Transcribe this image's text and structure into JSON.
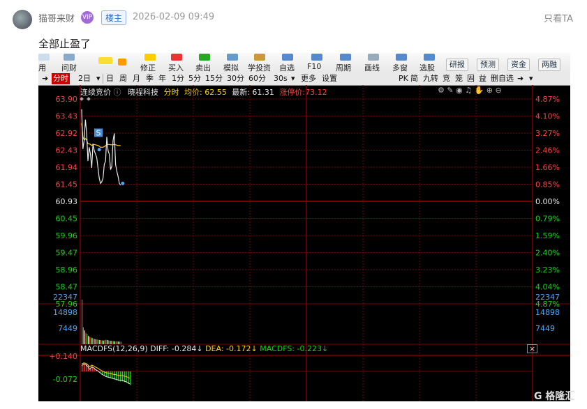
{
  "post": {
    "username": "猫哥来财",
    "vip_badge": "VIP",
    "owner_tag": "楼主",
    "timestamp": "2026-02-09 09:49",
    "only_ta": "只看TA",
    "content": "全部止盈了"
  },
  "toolbar": {
    "items": [
      "用",
      "问财",
      "修正",
      "买入",
      "卖出",
      "模拟",
      "学投资",
      "自选",
      "F10",
      "周期",
      "画线",
      "多窗",
      "选股"
    ],
    "buttons": [
      "研报",
      "预测",
      "资金",
      "两融"
    ]
  },
  "tabs": {
    "left": [
      "分时",
      "2日",
      "日",
      "周",
      "月",
      "季",
      "年",
      "1分",
      "5分",
      "15分",
      "30分",
      "60分",
      "30s",
      "更多",
      "设置"
    ],
    "right": [
      "PK",
      "简",
      "九转",
      "竞",
      "笼",
      "固",
      "益",
      "删自选"
    ]
  },
  "info": {
    "auction": "连续竞价",
    "stock": "晓程科技",
    "mode": "分时",
    "avg_label": "均价: 62.55",
    "latest_label": "最新: 61.31",
    "limit_label": "涨停价:73.12"
  },
  "macd": {
    "title": "MACDFS(12,26,9)",
    "diff": "DIFF: -0.284↓",
    "dea": "DEA: -0.172↓",
    "macdfs": "MACDFS: -0.223↓",
    "close": "×"
  },
  "axes": {
    "price_left": [
      "63.90",
      "63.43",
      "62.92",
      "62.43",
      "61.94",
      "61.45",
      "60.93",
      "60.45",
      "59.96",
      "59.47",
      "58.96",
      "58.47",
      "57.96"
    ],
    "pct_right": [
      "4.87%",
      "4.10%",
      "3.27%",
      "2.46%",
      "1.66%",
      "0.85%",
      "0.00%",
      "0.79%",
      "1.59%",
      "2.40%",
      "3.23%",
      "4.04%",
      "4.87%"
    ],
    "vol_left": [
      "22347",
      "14898",
      "7449"
    ],
    "vol_right": [
      "22347",
      "14898",
      "7449"
    ],
    "macd_left": [
      "+0.140",
      "-0.072"
    ]
  },
  "chart_data": {
    "type": "line",
    "title": "晓程科技 分时",
    "price": [
      63.6,
      62.45,
      62.7,
      63.3,
      62.9,
      62.1,
      62.5,
      62.3,
      61.9,
      62.6,
      62.4,
      62.3,
      62.2,
      61.9,
      61.6,
      61.45,
      61.5,
      61.6,
      62.0,
      62.1,
      62.8,
      62.4,
      62.3,
      61.85,
      61.95,
      62.7,
      62.9,
      62.0,
      61.8,
      61.65,
      61.45,
      61.4
    ],
    "avg": [
      63.2,
      62.8,
      62.7,
      62.75,
      62.7,
      62.6,
      62.6,
      62.58,
      62.55,
      62.58,
      62.58,
      62.57,
      62.56,
      62.55,
      62.53,
      62.5,
      62.5,
      62.5,
      62.52,
      62.54,
      62.58,
      62.58,
      62.58,
      62.57,
      62.57,
      62.57,
      62.58,
      62.57,
      62.56,
      62.55,
      62.55,
      62.55
    ],
    "volume": [
      21000,
      8000,
      6500,
      5400,
      4800,
      3900,
      3500,
      3200,
      2900,
      2600,
      2500,
      2300,
      2200,
      2100,
      2000,
      1900,
      1800,
      1700,
      1900,
      2100,
      2000,
      1800,
      1700,
      1600,
      1500,
      1450,
      1400,
      1350,
      1300,
      1250,
      1200,
      1150
    ],
    "macd_hist": [
      0.1,
      0.13,
      0.12,
      0.09,
      0.04,
      0.08,
      0.06,
      0.03,
      0.01,
      -0.02,
      -0.05,
      -0.07,
      -0.09,
      -0.1,
      -0.11,
      -0.12,
      -0.13,
      -0.14,
      -0.15,
      -0.16,
      -0.16,
      -0.17,
      -0.18,
      -0.2,
      -0.22
    ],
    "ylim": [
      57.96,
      63.9
    ],
    "prev_close": 60.93
  },
  "colors": {
    "up": "#ff4040",
    "down": "#19d219",
    "white": "#e8e8e8",
    "yellow": "#ffd400",
    "grid": "#7a0000"
  }
}
